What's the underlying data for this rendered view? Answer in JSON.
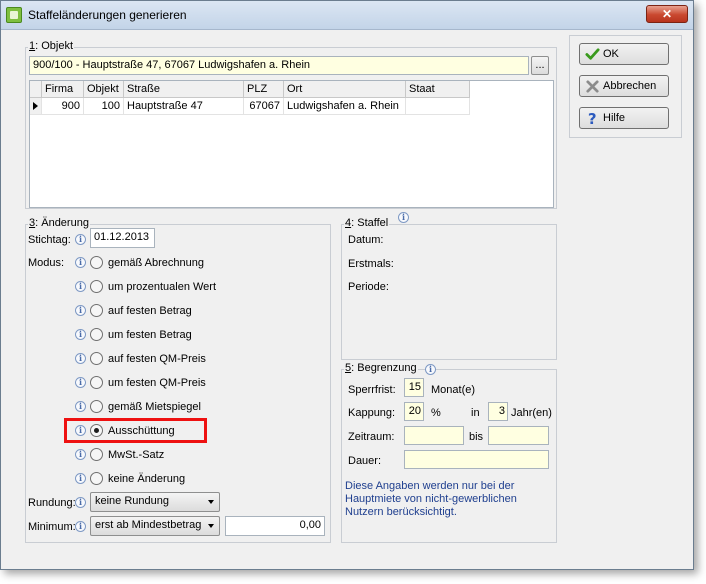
{
  "window": {
    "title": "Staffeländerungen generieren"
  },
  "buttons": {
    "ok": {
      "label": "OK",
      "underline": "O"
    },
    "cancel": {
      "label": "Abbrechen",
      "underline": "A"
    },
    "help": {
      "label": "Hilfe",
      "underline": "H"
    }
  },
  "objekt": {
    "group_num": "1",
    "group_label": ": Objekt",
    "value": "900/100 - Hauptstraße 47, 67067 Ludwigshafen a. Rhein",
    "browse_label": "...",
    "table": {
      "columns": [
        "Firma",
        "Objekt",
        "Straße",
        "PLZ",
        "Ort",
        "Staat"
      ],
      "rows": [
        {
          "firma": "900",
          "objekt": "100",
          "strasse": "Hauptstraße 47",
          "plz": "67067",
          "ort": "Ludwigshafen a. Rhein",
          "staat": ""
        }
      ]
    }
  },
  "aenderung": {
    "group_num": "3",
    "group_label": ": Änderung",
    "stichtag_label": "Stichtag:",
    "stichtag": "01.12.2013",
    "modus_label": "Modus:",
    "modus_options": [
      {
        "label": "gemäß Abrechnung",
        "checked": false
      },
      {
        "label": "um prozentualen Wert",
        "checked": false
      },
      {
        "label": "auf festen Betrag",
        "checked": false
      },
      {
        "label": "um festen Betrag",
        "checked": false
      },
      {
        "label": "auf festen QM-Preis",
        "checked": false
      },
      {
        "label": "um festen QM-Preis",
        "checked": false
      },
      {
        "label": "gemäß Mietspiegel",
        "checked": false
      },
      {
        "label": "Ausschüttung",
        "checked": true
      },
      {
        "label": "MwSt.-Satz",
        "checked": false
      },
      {
        "label": "keine Änderung",
        "checked": false
      }
    ],
    "rundung_label": "Rundung:",
    "rundung": "keine Rundung",
    "minimum_label": "Minimum:",
    "minimum_select": "erst ab Mindestbetrag",
    "minimum_value": "0,00"
  },
  "staffel": {
    "group_num": "4",
    "group_label": ": Staffel",
    "datum_label": "Datum:",
    "erstmals_label": "Erstmals:",
    "periode_label": "Periode:"
  },
  "begrenzung": {
    "group_num": "5",
    "group_label": ": Begrenzung",
    "sperrfrist_label": "Sperrfrist:",
    "sperrfrist": "15",
    "sperrfrist_unit": "Monat(e)",
    "kappung_label": "Kappung:",
    "kappung": "20",
    "kappung_unit": "%",
    "in_label": "in",
    "jahre": "3",
    "jahre_unit": "Jahr(en)",
    "zeitraum_label": "Zeitraum:",
    "zeitraum_from": "",
    "bis_label": "bis",
    "zeitraum_to": "",
    "dauer_label": "Dauer:",
    "dauer": "",
    "note": "Diese Angaben werden nur bei der Hauptmiete von nicht-gewerblichen Nutzern berücksichtigt."
  },
  "colors": {
    "accent": "#1f3f8f",
    "highlight": "#ee1111",
    "field_yellow": "#ffffe1"
  }
}
